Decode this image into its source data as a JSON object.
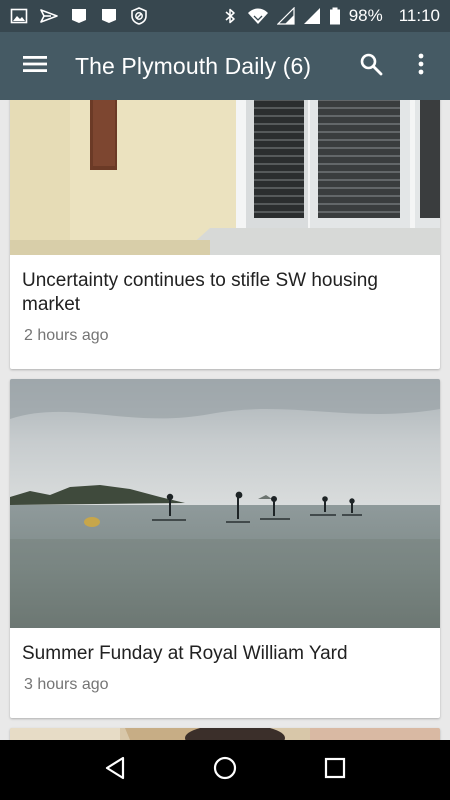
{
  "status_bar": {
    "battery": "98%",
    "time": "11:10"
  },
  "app_bar": {
    "title": "The Plymouth Daily (6)"
  },
  "articles": [
    {
      "headline": "Uncertainty continues to stifle SW housing market",
      "time": "2 hours ago"
    },
    {
      "headline": "Summer Funday  at Royal William Yard",
      "time": "3 hours ago"
    },
    {
      "headline": "",
      "time": ""
    }
  ],
  "icons": {
    "status_left": [
      "image-icon",
      "send-icon",
      "notification-icon",
      "notification-icon",
      "data-saver-icon"
    ],
    "status_right": [
      "bluetooth-icon",
      "wifi-icon",
      "signal-icon",
      "signal-icon",
      "battery-icon"
    ],
    "app_bar": [
      "menu-icon",
      "search-icon",
      "more-vert-icon"
    ],
    "nav": [
      "back-icon",
      "home-icon",
      "recents-icon"
    ]
  },
  "colors": {
    "status_bar": "#37474f",
    "app_bar": "#455a64",
    "background": "#e9e9e9"
  }
}
